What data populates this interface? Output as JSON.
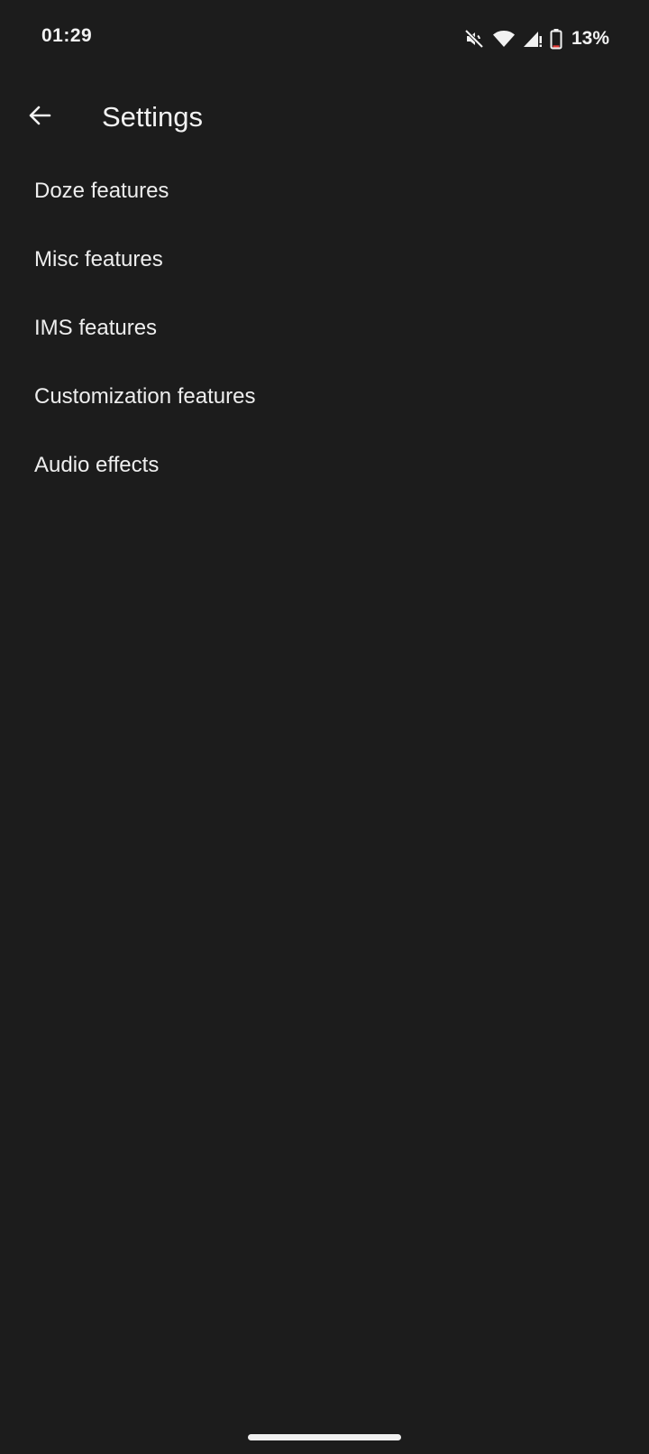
{
  "status_bar": {
    "time": "01:29",
    "battery_percent": "13%",
    "icons": [
      "mute-icon",
      "wifi-icon",
      "signal-icon",
      "battery-icon"
    ],
    "battery_level": 0.13,
    "battery_color": "#e53935"
  },
  "app_bar": {
    "title": "Settings",
    "back_icon": "arrow-back-icon"
  },
  "settings": {
    "items": [
      {
        "label": "Doze features"
      },
      {
        "label": "Misc features"
      },
      {
        "label": "IMS features"
      },
      {
        "label": "Customization features"
      },
      {
        "label": "Audio effects"
      }
    ]
  },
  "theme": {
    "background": "#1c1c1c",
    "text": "#eeeeee"
  }
}
